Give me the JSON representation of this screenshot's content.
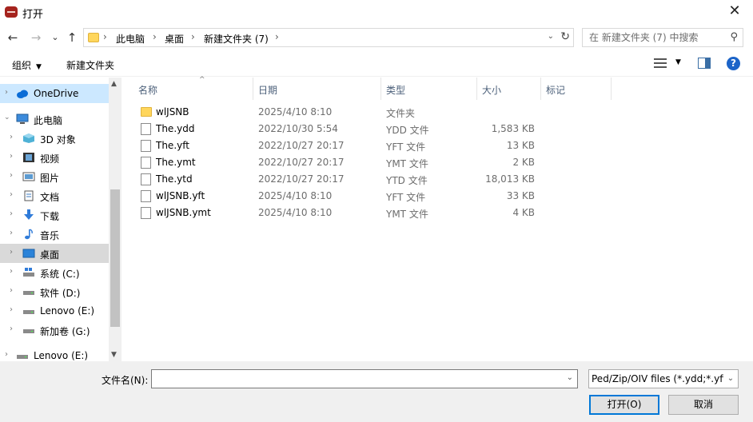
{
  "window": {
    "title": "打开",
    "close_label": "✕"
  },
  "nav": {
    "back": "←",
    "forward": "→",
    "recent": "⌄",
    "up": "↑"
  },
  "address": {
    "breadcrumbs": [
      "此电脑",
      "桌面",
      "新建文件夹 (7)"
    ],
    "separator": "›",
    "dropdown": "⌄",
    "refresh": "↻"
  },
  "search": {
    "placeholder": "在 新建文件夹 (7) 中搜索",
    "icon": "search-icon"
  },
  "toolbar": {
    "organize": "组织",
    "new_folder": "新建文件夹"
  },
  "sidebar": {
    "items": [
      {
        "label": "OneDrive",
        "icon": "cloud-icon"
      },
      {
        "label": "此电脑",
        "icon": "computer-icon"
      },
      {
        "label": "3D 对象",
        "icon": "cube-icon"
      },
      {
        "label": "视频",
        "icon": "video-icon"
      },
      {
        "label": "图片",
        "icon": "picture-icon"
      },
      {
        "label": "文档",
        "icon": "document-icon"
      },
      {
        "label": "下载",
        "icon": "download-icon"
      },
      {
        "label": "音乐",
        "icon": "music-icon"
      },
      {
        "label": "桌面",
        "icon": "desktop-icon"
      },
      {
        "label": "系统 (C:)",
        "icon": "drive-icon"
      },
      {
        "label": "软件 (D:)",
        "icon": "drive-icon"
      },
      {
        "label": "Lenovo (E:)",
        "icon": "drive-icon"
      },
      {
        "label": "新加卷 (G:)",
        "icon": "drive-icon"
      },
      {
        "label": "Lenovo (E:)",
        "icon": "drive-icon"
      }
    ]
  },
  "columns": {
    "name": "名称",
    "date": "日期",
    "type": "类型",
    "size": "大小",
    "tags": "标记"
  },
  "files": [
    {
      "name": "wlJSNB",
      "date": "2025/4/10 8:10",
      "type": "文件夹",
      "size": "",
      "kind": "folder"
    },
    {
      "name": "The.ydd",
      "date": "2022/10/30 5:54",
      "type": "YDD 文件",
      "size": "1,583 KB",
      "kind": "doc"
    },
    {
      "name": "The.yft",
      "date": "2022/10/27 20:17",
      "type": "YFT 文件",
      "size": "13 KB",
      "kind": "doc"
    },
    {
      "name": "The.ymt",
      "date": "2022/10/27 20:17",
      "type": "YMT 文件",
      "size": "2 KB",
      "kind": "doc"
    },
    {
      "name": "The.ytd",
      "date": "2022/10/27 20:17",
      "type": "YTD 文件",
      "size": "18,013 KB",
      "kind": "doc"
    },
    {
      "name": "wlJSNB.yft",
      "date": "2025/4/10 8:10",
      "type": "YFT 文件",
      "size": "33 KB",
      "kind": "doc"
    },
    {
      "name": "wlJSNB.ymt",
      "date": "2025/4/10 8:10",
      "type": "YMT 文件",
      "size": "4 KB",
      "kind": "doc"
    }
  ],
  "footer": {
    "filename_label": "文件名(N):",
    "filename_value": "",
    "filter": "Ped/Zip/OIV files (*.ydd;*.yft;",
    "open_label": "打开(O)",
    "cancel_label": "取消"
  },
  "colors": {
    "accent": "#0078d7",
    "selection": "#cce8ff",
    "header_text": "#4c607a"
  }
}
